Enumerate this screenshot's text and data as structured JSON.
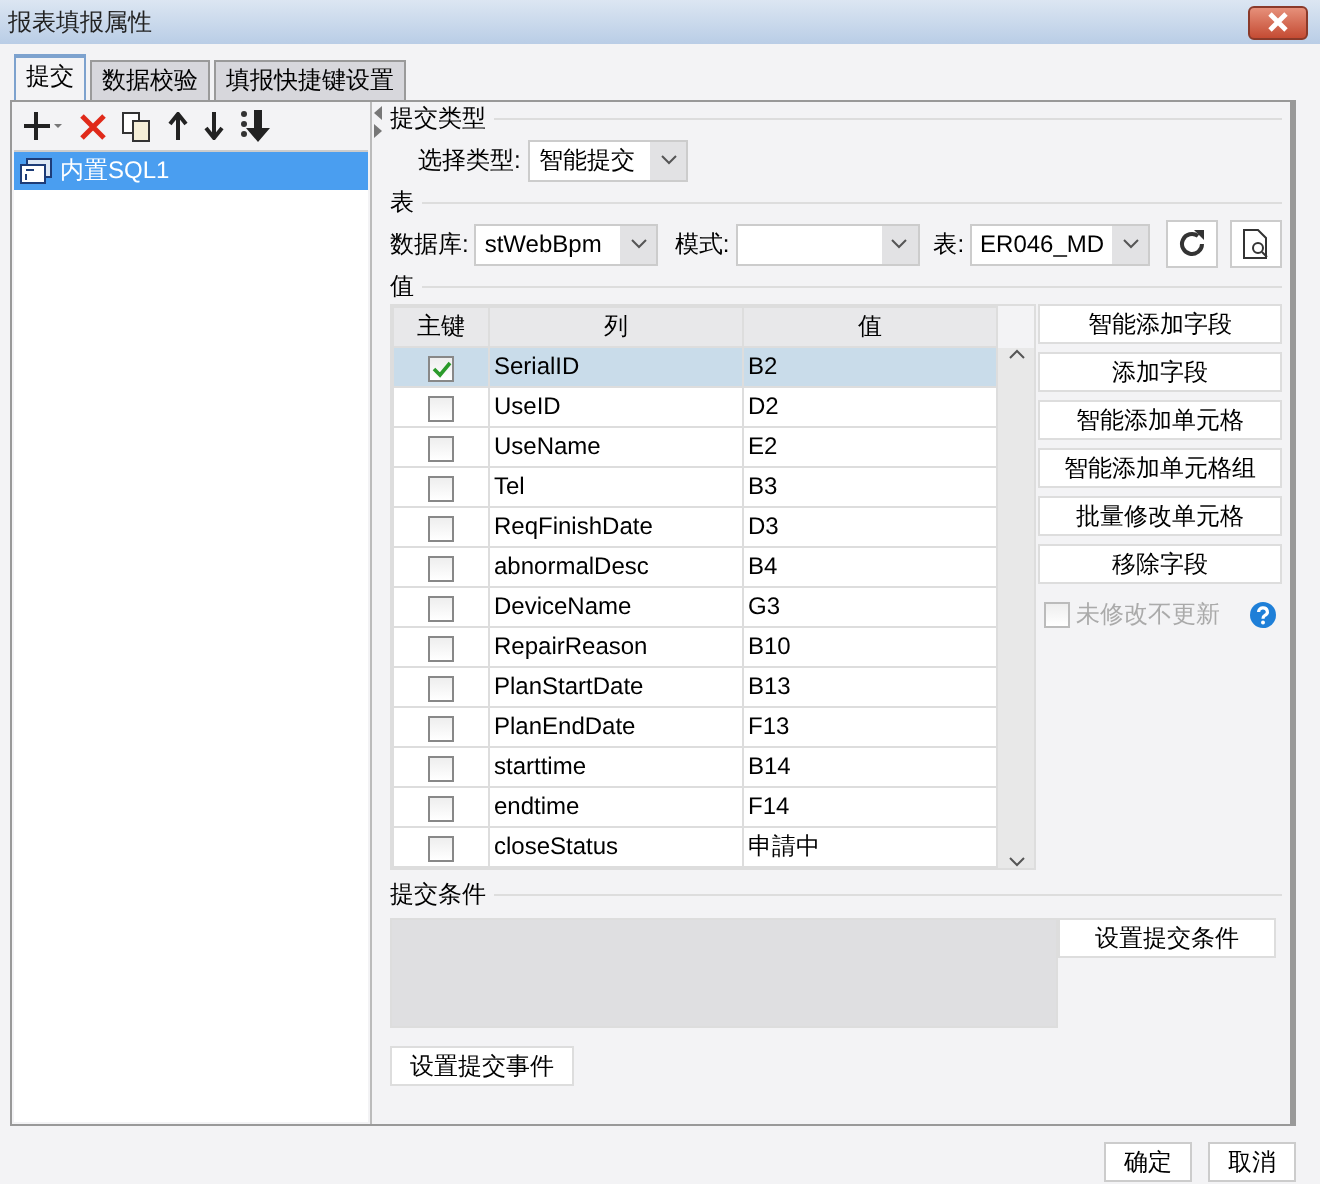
{
  "window": {
    "title": "报表填报属性"
  },
  "tabs": [
    {
      "label": "提交",
      "selected": true
    },
    {
      "label": "数据校验",
      "selected": false
    },
    {
      "label": "填报快捷键设置",
      "selected": false
    }
  ],
  "sidebar": {
    "items": [
      {
        "label": "内置SQL1",
        "selected": true
      }
    ]
  },
  "submit_type": {
    "heading": "提交类型",
    "label": "选择类型:",
    "value": "智能提交"
  },
  "table_section": {
    "heading": "表",
    "database_label": "数据库:",
    "database": "stWebBpm",
    "schema_label": "模式:",
    "table_label": "表:",
    "table": "ER046_MD"
  },
  "values": {
    "heading": "值",
    "columns": [
      "主键",
      "列",
      "值"
    ],
    "rows": [
      {
        "key": true,
        "column": "SerialID",
        "value": "B2",
        "selected": true
      },
      {
        "key": false,
        "column": "UseID",
        "value": "D2",
        "selected": false
      },
      {
        "key": false,
        "column": "UseName",
        "value": "E2",
        "selected": false
      },
      {
        "key": false,
        "column": "Tel",
        "value": "B3",
        "selected": false
      },
      {
        "key": false,
        "column": "ReqFinishDate",
        "value": "D3",
        "selected": false
      },
      {
        "key": false,
        "column": "abnormalDesc",
        "value": "B4",
        "selected": false
      },
      {
        "key": false,
        "column": "DeviceName",
        "value": "G3",
        "selected": false
      },
      {
        "key": false,
        "column": "RepairReason",
        "value": "B10",
        "selected": false
      },
      {
        "key": false,
        "column": "PlanStartDate",
        "value": "B13",
        "selected": false
      },
      {
        "key": false,
        "column": "PlanEndDate",
        "value": "F13",
        "selected": false
      },
      {
        "key": false,
        "column": "starttime",
        "value": "B14",
        "selected": false
      },
      {
        "key": false,
        "column": "endtime",
        "value": "F14",
        "selected": false
      },
      {
        "key": false,
        "column": "closeStatus",
        "value": "申請中",
        "selected": false
      }
    ],
    "buttons": [
      "智能添加字段",
      "添加字段",
      "智能添加单元格",
      "智能添加单元格组",
      "批量修改单元格",
      "移除字段"
    ],
    "no_update": {
      "label": "未修改不更新",
      "checked": false,
      "disabled": true
    }
  },
  "conditions": {
    "heading": "提交条件",
    "button": "设置提交条件"
  },
  "event_button": "设置提交事件",
  "footer_buttons": [
    "确定",
    "取消"
  ]
}
